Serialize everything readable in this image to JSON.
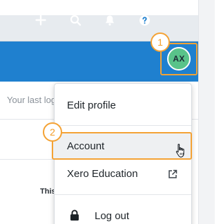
{
  "navbar": {
    "icons": [
      "plus-icon",
      "search-icon",
      "bell-icon",
      "help-icon"
    ],
    "avatar_initials": "AX",
    "accent_color": "#1f80cf",
    "avatar_color": "#59c38a"
  },
  "steps": {
    "step1": "1",
    "step2": "2",
    "highlight_color": "#f4a234"
  },
  "background": {
    "last_login_text": "Your last log",
    "partial_text": "This"
  },
  "menu": {
    "edit_profile": "Edit profile",
    "account": "Account",
    "xero_education": "Xero Education",
    "log_out": "Log out"
  }
}
